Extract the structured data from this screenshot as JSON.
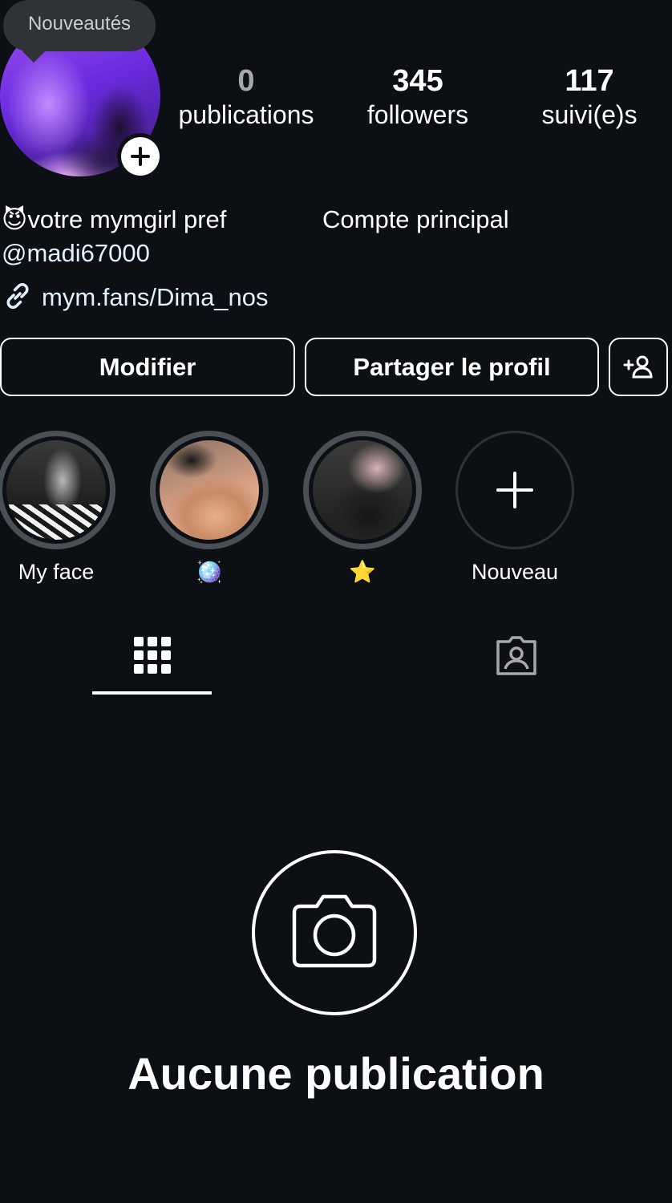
{
  "tooltip": {
    "text": "Nouveautés"
  },
  "stats": [
    {
      "value": "0",
      "label": "publications"
    },
    {
      "value": "345",
      "label": "followers"
    },
    {
      "value": "117",
      "label": "suivi(e)s"
    }
  ],
  "bio": {
    "emoji": "😈",
    "name": "votre mymgirl pref",
    "account_type": "Compte principal",
    "mention": "@madi67000",
    "link": "mym.fans/Dima_nos"
  },
  "buttons": {
    "edit": "Modifier",
    "share": "Partager le profil"
  },
  "highlights": [
    {
      "label": "My face"
    },
    {
      "label": "🪩"
    },
    {
      "label": "⭐"
    },
    {
      "label": "Nouveau"
    }
  ],
  "empty_state": {
    "title": "Aucune publication"
  },
  "colors": {
    "background": "#0c1014",
    "text": "#ffffff",
    "link": "#e0f1ff",
    "tooltip": "#2f3337",
    "ring": "#4a4f55"
  }
}
